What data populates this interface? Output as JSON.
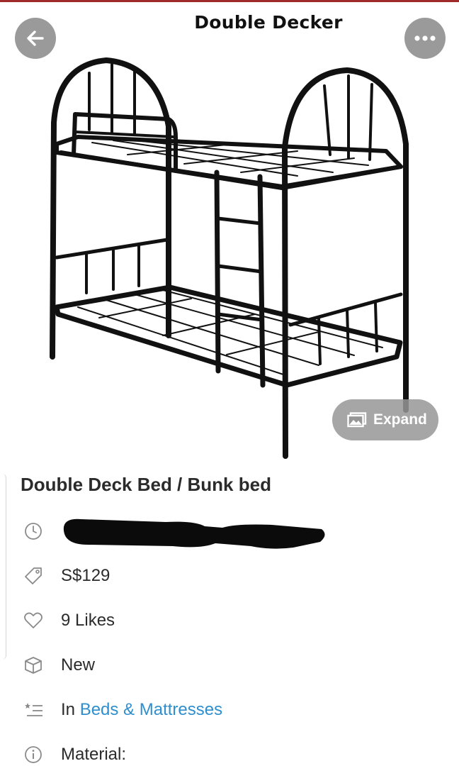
{
  "hero": {
    "caption": "Double Decker",
    "expand_label": "Expand"
  },
  "listing": {
    "title": "Double Deck Bed / Bunk bed",
    "price": "S$129",
    "likes": "9 Likes",
    "condition": "New",
    "category_prefix": "In",
    "category_link": "Beds & Mattresses",
    "material_label": "Material:"
  },
  "colors": {
    "link": "#2f8fce",
    "icon": "#8a8a8a",
    "top_accent": "#9e2a2b"
  },
  "icons": [
    "back-arrow-icon",
    "more-icon",
    "expand-image-icon",
    "clock-icon",
    "price-tag-icon",
    "heart-icon",
    "box-icon",
    "category-list-icon",
    "info-icon"
  ]
}
